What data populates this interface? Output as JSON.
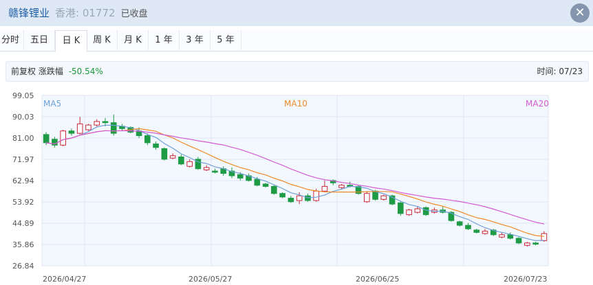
{
  "header": {
    "name": "赣锋锂业",
    "market": "香港: 01772",
    "status": "已收盘",
    "close_symbol": "✕"
  },
  "tabs": [
    {
      "label": "分时"
    },
    {
      "label": "五日"
    },
    {
      "label": "日 K",
      "active": true
    },
    {
      "label": "周 K"
    },
    {
      "label": "月 K"
    },
    {
      "label": "1 年"
    },
    {
      "label": "3 年"
    },
    {
      "label": "5 年"
    }
  ],
  "info": {
    "adjust": "前复权",
    "chg_label": "涨跌幅",
    "chg_value": "-50.54%",
    "time_label": "时间: 07/23"
  },
  "colors": {
    "up": "#c8283a",
    "down": "#1e9b45",
    "ma5": "#6fa0d8",
    "ma10": "#f08a28",
    "ma20": "#d45ad4"
  },
  "chart_data": {
    "type": "candlestick",
    "y_ticks": [
      "99.05",
      "90.03",
      "81.00",
      "71.97",
      "62.94",
      "53.92",
      "44.89",
      "35.86",
      "26.84"
    ],
    "ylim": [
      26.84,
      99.05
    ],
    "x_ticks": [
      "2026/04/27",
      "2026/05/27",
      "2026/06/25",
      "2026/07/23"
    ],
    "legend": [
      "MA5",
      "MA10",
      "MA20"
    ],
    "candles": [
      [
        82.5,
        79.0,
        83.5,
        78.0
      ],
      [
        80.5,
        78.0,
        81.5,
        77.0
      ],
      [
        78.0,
        84.0,
        84.5,
        77.5
      ],
      [
        84.0,
        83.0,
        85.0,
        82.0
      ],
      [
        83.0,
        87.0,
        90.0,
        82.5
      ],
      [
        84.5,
        86.5,
        87.0,
        84.0
      ],
      [
        86.5,
        88.0,
        89.0,
        85.5
      ],
      [
        88.0,
        87.5,
        89.5,
        86.0
      ],
      [
        87.5,
        83.0,
        91.0,
        82.0
      ],
      [
        86.0,
        85.0,
        87.0,
        84.0
      ],
      [
        85.5,
        83.5,
        86.0,
        83.0
      ],
      [
        84.0,
        82.0,
        85.5,
        81.0
      ],
      [
        82.0,
        79.0,
        83.0,
        78.0
      ],
      [
        78.5,
        77.0,
        79.5,
        76.0
      ],
      [
        76.5,
        72.0,
        77.0,
        71.5
      ],
      [
        72.5,
        73.5,
        74.5,
        72.0
      ],
      [
        73.0,
        70.0,
        74.0,
        69.5
      ],
      [
        69.0,
        71.0,
        72.0,
        68.5
      ],
      [
        72.0,
        68.0,
        73.0,
        67.5
      ],
      [
        67.5,
        68.5,
        69.5,
        67.0
      ],
      [
        67.0,
        66.5,
        68.0,
        66.0
      ],
      [
        68.0,
        66.0,
        69.0,
        65.0
      ],
      [
        67.0,
        65.0,
        68.5,
        64.0
      ],
      [
        65.5,
        64.0,
        66.5,
        63.0
      ],
      [
        65.0,
        63.0,
        66.0,
        62.5
      ],
      [
        63.5,
        61.0,
        64.5,
        60.5
      ],
      [
        61.5,
        60.5,
        62.0,
        60.0
      ],
      [
        60.5,
        57.5,
        61.0,
        57.0
      ],
      [
        57.5,
        56.0,
        58.0,
        55.5
      ],
      [
        55.5,
        54.0,
        56.5,
        53.5
      ],
      [
        54.5,
        56.5,
        58.0,
        53.0
      ],
      [
        56.5,
        54.5,
        57.5,
        54.0
      ],
      [
        54.5,
        58.5,
        59.5,
        54.0
      ],
      [
        58.5,
        60.5,
        63.0,
        58.0
      ],
      [
        63.0,
        62.0,
        63.5,
        61.0
      ],
      [
        60.0,
        61.0,
        61.5,
        59.5
      ],
      [
        61.0,
        60.5,
        62.5,
        60.0
      ],
      [
        60.5,
        57.5,
        61.0,
        57.0
      ],
      [
        54.0,
        57.5,
        58.5,
        53.5
      ],
      [
        58.5,
        55.0,
        59.0,
        54.5
      ],
      [
        55.0,
        56.5,
        57.0,
        54.5
      ],
      [
        56.5,
        53.0,
        57.0,
        52.5
      ],
      [
        53.5,
        49.0,
        54.0,
        48.0
      ],
      [
        48.5,
        50.5,
        51.0,
        48.0
      ],
      [
        49.5,
        51.0,
        52.0,
        49.0
      ],
      [
        51.5,
        48.5,
        52.0,
        48.0
      ],
      [
        49.5,
        50.5,
        51.5,
        49.0
      ],
      [
        50.5,
        49.5,
        52.0,
        49.0
      ],
      [
        49.5,
        46.0,
        50.0,
        45.5
      ],
      [
        45.5,
        44.0,
        46.0,
        43.5
      ],
      [
        44.0,
        42.5,
        45.0,
        42.0
      ],
      [
        42.0,
        41.0,
        42.5,
        40.5
      ],
      [
        40.5,
        41.5,
        42.5,
        40.0
      ],
      [
        42.0,
        40.0,
        42.5,
        39.5
      ],
      [
        39.0,
        40.0,
        41.0,
        38.5
      ],
      [
        40.0,
        38.5,
        41.0,
        38.0
      ],
      [
        38.5,
        36.5,
        39.0,
        36.0
      ],
      [
        35.5,
        36.5,
        37.0,
        35.0
      ],
      [
        36.5,
        36.0,
        37.0,
        35.5
      ],
      [
        37.5,
        40.5,
        41.5,
        37.0
      ]
    ]
  }
}
